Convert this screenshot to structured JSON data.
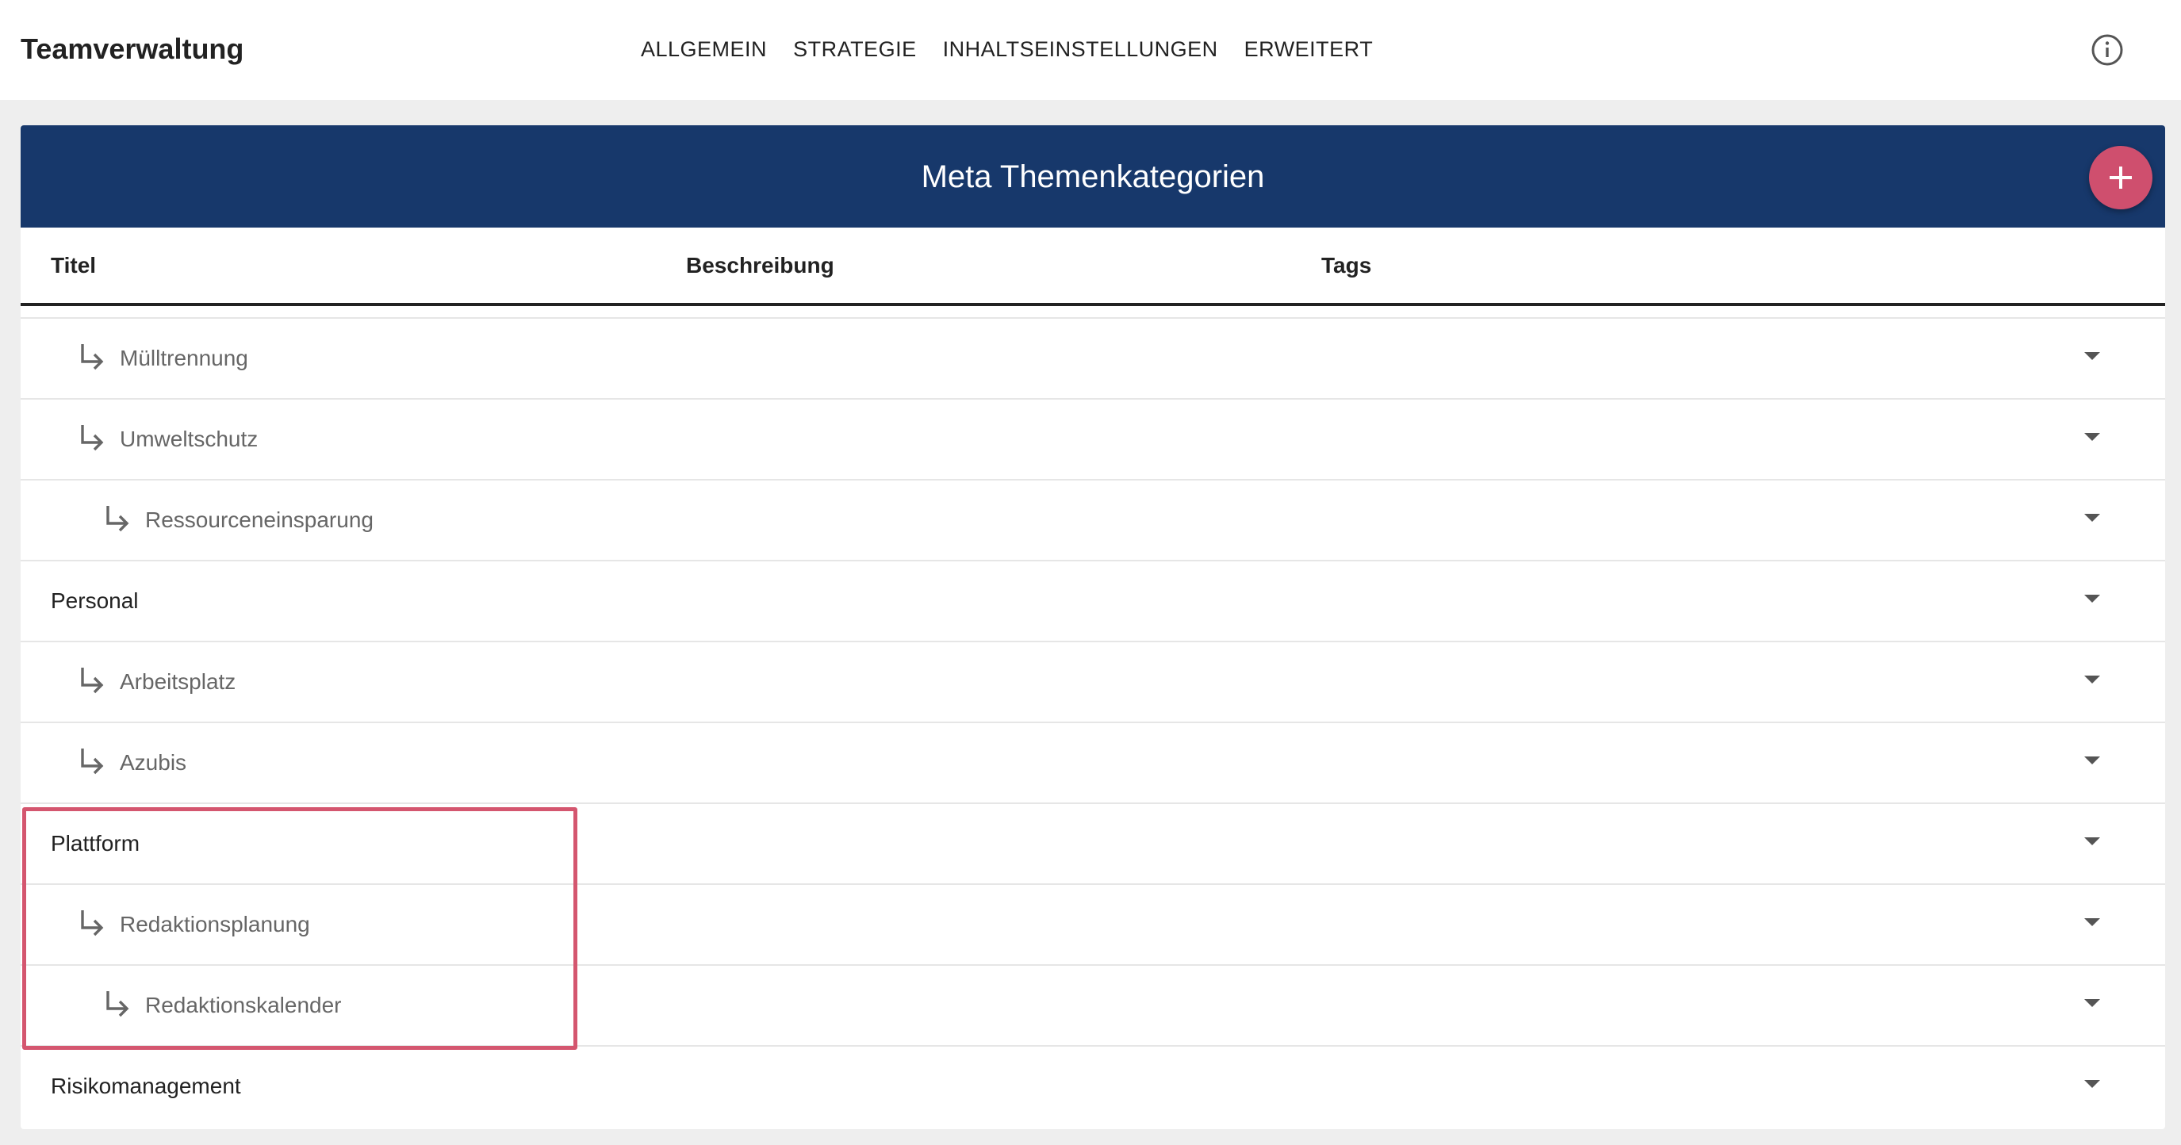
{
  "app": {
    "title": "Teamverwaltung"
  },
  "nav": {
    "items": [
      {
        "label": "ALLGEMEIN"
      },
      {
        "label": "STRATEGIE"
      },
      {
        "label": "INHALTSEINSTELLUNGEN"
      },
      {
        "label": "ERWEITERT"
      }
    ]
  },
  "card": {
    "title": "Meta Themenkategorien",
    "add_button_icon": "plus-icon",
    "header_color": "#17386b",
    "add_button_color": "#cf4f6e"
  },
  "table": {
    "columns": [
      "Titel",
      "Beschreibung",
      "Tags"
    ],
    "rows": [
      {
        "title": "Mülltrennung",
        "level": 1
      },
      {
        "title": "Umweltschutz",
        "level": 1
      },
      {
        "title": "Ressourceneinsparung",
        "level": 2
      },
      {
        "title": "Personal",
        "level": 0
      },
      {
        "title": "Arbeitsplatz",
        "level": 1
      },
      {
        "title": "Azubis",
        "level": 1
      },
      {
        "title": "Plattform",
        "level": 0
      },
      {
        "title": "Redaktionsplanung",
        "level": 1
      },
      {
        "title": "Redaktionskalender",
        "level": 2
      },
      {
        "title": "Risikomanagement",
        "level": 0
      }
    ]
  },
  "highlight": {
    "color": "#d4566f"
  }
}
